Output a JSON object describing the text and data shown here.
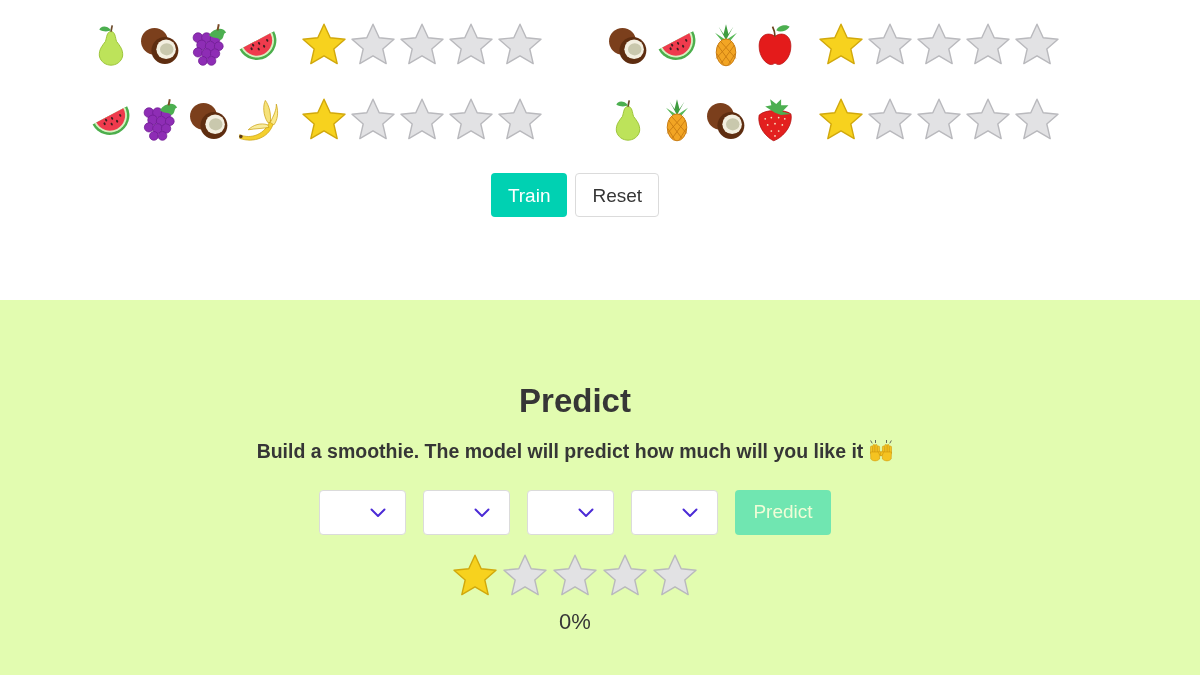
{
  "training": {
    "rows": [
      {
        "fruits": [
          {
            "kind": "pear"
          },
          {
            "kind": "coconut"
          },
          {
            "kind": "grapes"
          },
          {
            "kind": "watermelon"
          }
        ],
        "stars": 1
      },
      {
        "fruits": [
          {
            "kind": "coconut"
          },
          {
            "kind": "watermelon"
          },
          {
            "kind": "pineapple"
          },
          {
            "kind": "apple"
          }
        ],
        "stars": 1
      },
      {
        "fruits": [
          {
            "kind": "watermelon"
          },
          {
            "kind": "grapes"
          },
          {
            "kind": "coconut"
          },
          {
            "kind": "banana"
          }
        ],
        "stars": 1
      },
      {
        "fruits": [
          {
            "kind": "pear"
          },
          {
            "kind": "pineapple"
          },
          {
            "kind": "coconut"
          },
          {
            "kind": "strawberry"
          }
        ],
        "stars": 1
      }
    ],
    "buttons": [
      {
        "label": "Train",
        "kind": "primary"
      },
      {
        "label": "Reset",
        "kind": "default"
      }
    ]
  },
  "predict": {
    "title": "Predict",
    "subtitle": "Build a smoothie. The model will predict how much will you like it",
    "selects": [
      {
        "kind": "dropdown"
      },
      {
        "kind": "dropdown"
      },
      {
        "kind": "dropdown"
      },
      {
        "kind": "dropdown"
      }
    ],
    "button": {
      "label": "Predict",
      "disabled": true
    },
    "result": {
      "stars": 1,
      "reading": "0%"
    }
  }
}
